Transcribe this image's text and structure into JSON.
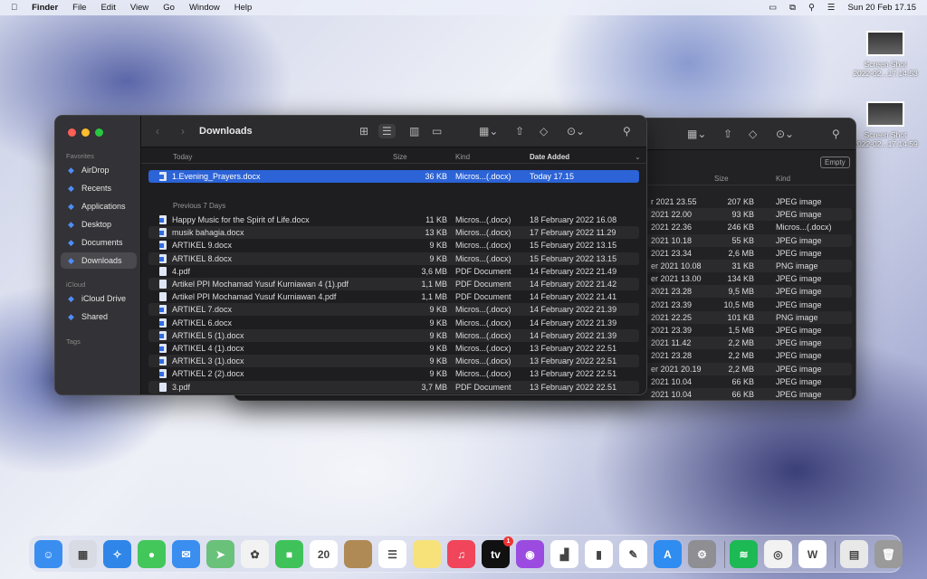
{
  "menubar": {
    "apple": "",
    "app": "Finder",
    "items": [
      "File",
      "Edit",
      "View",
      "Go",
      "Window",
      "Help"
    ],
    "clock": "Sun 20 Feb  17.15"
  },
  "desktop": [
    {
      "name": "Screen Shot",
      "sub": "2022-02...17.14.53"
    },
    {
      "name": "Screen Shot",
      "sub": "2022-02...17.14.59"
    }
  ],
  "back_window": {
    "empty_label": "Empty",
    "columns": {
      "size": "Size",
      "kind": "Kind"
    },
    "rows": [
      [
        "r 2021 23.55",
        "207 KB",
        "JPEG image"
      ],
      [
        "2021 22.00",
        "93 KB",
        "JPEG image"
      ],
      [
        "2021 22.36",
        "246 KB",
        "Micros...(.docx)"
      ],
      [
        "2021 10.18",
        "55 KB",
        "JPEG image"
      ],
      [
        "2021 23.34",
        "2,6 MB",
        "JPEG image"
      ],
      [
        "er 2021 10.08",
        "31 KB",
        "PNG image"
      ],
      [
        "er 2021 13.00",
        "134 KB",
        "JPEG image"
      ],
      [
        "2021 23.28",
        "9,5 MB",
        "JPEG image"
      ],
      [
        "2021 23.39",
        "10,5 MB",
        "JPEG image"
      ],
      [
        "2021 22.25",
        "101 KB",
        "PNG image"
      ],
      [
        "2021 23.39",
        "1,5 MB",
        "JPEG image"
      ],
      [
        "2021 11.42",
        "2,2 MB",
        "JPEG image"
      ],
      [
        "2021 23.28",
        "2,2 MB",
        "JPEG image"
      ],
      [
        "er 2021 20.19",
        "2,2 MB",
        "JPEG image"
      ],
      [
        "2021 10.04",
        "66 KB",
        "JPEG image"
      ],
      [
        "2021 10.04",
        "66 KB",
        "JPEG image"
      ]
    ]
  },
  "sidebar": {
    "favorites_label": "Favorites",
    "favorites": [
      {
        "label": "AirDrop",
        "icon": "airdrop-icon"
      },
      {
        "label": "Recents",
        "icon": "clock-icon"
      },
      {
        "label": "Applications",
        "icon": "applications-icon"
      },
      {
        "label": "Desktop",
        "icon": "desktop-icon"
      },
      {
        "label": "Documents",
        "icon": "document-icon"
      },
      {
        "label": "Downloads",
        "icon": "downloads-icon",
        "selected": true
      }
    ],
    "icloud_label": "iCloud",
    "icloud": [
      {
        "label": "iCloud Drive",
        "icon": "cloud-icon"
      },
      {
        "label": "Shared",
        "icon": "shared-folder-icon"
      }
    ],
    "tags_label": "Tags"
  },
  "window": {
    "title": "Downloads",
    "columns": {
      "name": "Today",
      "size": "Size",
      "kind": "Kind",
      "date": "Date Added"
    },
    "today": [
      {
        "name": "1.Evening_Prayers.docx",
        "size": "36 KB",
        "kind": "Micros...(.docx)",
        "date": "Today 17.15",
        "type": "doc",
        "selected": true
      }
    ],
    "prev_label": "Previous 7 Days",
    "previous": [
      {
        "name": "Happy Music for the Spirit of Life.docx",
        "size": "11 KB",
        "kind": "Micros...(.docx)",
        "date": "18 February 2022 16.08",
        "type": "doc"
      },
      {
        "name": "musik bahagia.docx",
        "size": "13 KB",
        "kind": "Micros...(.docx)",
        "date": "17 February 2022 11.29",
        "type": "doc"
      },
      {
        "name": "ARTIKEL 9.docx",
        "size": "9 KB",
        "kind": "Micros...(.docx)",
        "date": "15 February 2022 13.15",
        "type": "doc"
      },
      {
        "name": "ARTIKEL 8.docx",
        "size": "9 KB",
        "kind": "Micros...(.docx)",
        "date": "15 February 2022 13.15",
        "type": "doc"
      },
      {
        "name": "4.pdf",
        "size": "3,6 MB",
        "kind": "PDF Document",
        "date": "14 February 2022 21.49",
        "type": "pdf"
      },
      {
        "name": "Artikel PPI Mochamad Yusuf Kurniawan 4 (1).pdf",
        "size": "1,1 MB",
        "kind": "PDF Document",
        "date": "14 February 2022 21.42",
        "type": "pdf"
      },
      {
        "name": "Artikel PPI Mochamad Yusuf Kurniawan 4.pdf",
        "size": "1,1 MB",
        "kind": "PDF Document",
        "date": "14 February 2022 21.41",
        "type": "pdf"
      },
      {
        "name": "ARTIKEL 7.docx",
        "size": "9 KB",
        "kind": "Micros...(.docx)",
        "date": "14 February 2022 21.39",
        "type": "doc"
      },
      {
        "name": "ARTIKEL 6.docx",
        "size": "9 KB",
        "kind": "Micros...(.docx)",
        "date": "14 February 2022 21.39",
        "type": "doc"
      },
      {
        "name": "ARTIKEL 5 (1).docx",
        "size": "9 KB",
        "kind": "Micros...(.docx)",
        "date": "14 February 2022 21.39",
        "type": "doc"
      },
      {
        "name": "ARTIKEL 4 (1).docx",
        "size": "9 KB",
        "kind": "Micros...(.docx)",
        "date": "13 February 2022 22.51",
        "type": "doc"
      },
      {
        "name": "ARTIKEL 3 (1).docx",
        "size": "9 KB",
        "kind": "Micros...(.docx)",
        "date": "13 February 2022 22.51",
        "type": "doc"
      },
      {
        "name": "ARTIKEL 2 (2).docx",
        "size": "9 KB",
        "kind": "Micros...(.docx)",
        "date": "13 February 2022 22.51",
        "type": "doc"
      },
      {
        "name": "3.pdf",
        "size": "3,7 MB",
        "kind": "PDF Document",
        "date": "13 February 2022 22.51",
        "type": "pdf"
      }
    ]
  },
  "dock": [
    {
      "name": "finder",
      "bg": "#3a8ef0",
      "g": "☺"
    },
    {
      "name": "launchpad",
      "bg": "#d8dbe3",
      "g": "▦"
    },
    {
      "name": "safari",
      "bg": "#2f86e8",
      "g": "✧"
    },
    {
      "name": "messages",
      "bg": "#43c75a",
      "g": "●"
    },
    {
      "name": "mail",
      "bg": "#3a8ef0",
      "g": "✉"
    },
    {
      "name": "maps",
      "bg": "#6ac17a",
      "g": "➤"
    },
    {
      "name": "photos",
      "bg": "#f2f2f2",
      "g": "✿"
    },
    {
      "name": "facetime",
      "bg": "#3fc25a",
      "g": "■"
    },
    {
      "name": "calendar",
      "bg": "#ffffff",
      "g": "20",
      "label": "FEB"
    },
    {
      "name": "notes-board",
      "bg": "#b08a55",
      "g": ""
    },
    {
      "name": "reminders",
      "bg": "#ffffff",
      "g": "☰"
    },
    {
      "name": "notes",
      "bg": "#f7e27a",
      "g": ""
    },
    {
      "name": "music",
      "bg": "#f0455a",
      "g": "♫"
    },
    {
      "name": "apple-tv",
      "bg": "#111111",
      "g": "tv",
      "badge": "1"
    },
    {
      "name": "podcasts",
      "bg": "#9b4be0",
      "g": "◉"
    },
    {
      "name": "keynote",
      "bg": "#ffffff",
      "g": "▟"
    },
    {
      "name": "numbers",
      "bg": "#ffffff",
      "g": "▮"
    },
    {
      "name": "pages",
      "bg": "#ffffff",
      "g": "✎"
    },
    {
      "name": "app-store",
      "bg": "#2f8cf0",
      "g": "A"
    },
    {
      "name": "system-preferences",
      "bg": "#8e8e93",
      "g": "⚙"
    },
    {
      "sep": true
    },
    {
      "name": "spotify",
      "bg": "#1db954",
      "g": "≋"
    },
    {
      "name": "chrome",
      "bg": "#f2f2f2",
      "g": "◎"
    },
    {
      "name": "word",
      "bg": "#ffffff",
      "g": "W"
    },
    {
      "sep": true
    },
    {
      "name": "document",
      "bg": "#e8e8e8",
      "g": "▤"
    },
    {
      "name": "trash",
      "bg": "#9a9a9a",
      "g": "🗑"
    }
  ]
}
